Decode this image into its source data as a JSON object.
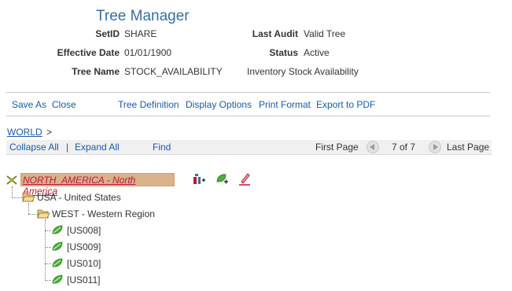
{
  "header": {
    "title": "Tree Manager",
    "setid_label": "SetID",
    "setid_value": "SHARE",
    "effdate_label": "Effective Date",
    "effdate_value": "01/01/1900",
    "treename_label": "Tree Name",
    "treename_value": "STOCK_AVAILABILITY",
    "tree_desc": "Inventory Stock Availability",
    "lastaudit_label": "Last Audit",
    "lastaudit_value": "Valid Tree",
    "status_label": "Status",
    "status_value": "Active"
  },
  "toolbar": {
    "save_as": "Save As",
    "close": "Close",
    "tree_definition": "Tree Definition",
    "display_options": "Display Options",
    "print_format": "Print Format",
    "export_pdf": "Export to PDF"
  },
  "breadcrumb": {
    "root": "WORLD",
    "separator": ">"
  },
  "navbar": {
    "collapse_all": "Collapse All",
    "separator": "|",
    "expand_all": "Expand All",
    "find": "Find",
    "first_page": "First Page",
    "page_info": "7 of 7",
    "last_page": "Last Page"
  },
  "tree": {
    "root": "NORTH_AMERICA - North America",
    "level1": "USA - United States",
    "level2": "WEST - Western Region",
    "details": [
      "[US008]",
      "[US009]",
      "[US010]",
      "[US011]"
    ]
  },
  "icons": {
    "root_node": "tree-root-icon",
    "insert_child": "insert-child-icon",
    "insert_detail": "insert-leaf-icon",
    "edit": "edit-pencil-icon",
    "folder": "open-folder-icon",
    "leaf": "leaf-icon"
  },
  "colors": {
    "title": "#3a6e9c",
    "link": "#1a5aa6",
    "root_highlight": "#d9b28a",
    "root_text": "#c0143c",
    "leaf_green": "#4caf3a"
  }
}
